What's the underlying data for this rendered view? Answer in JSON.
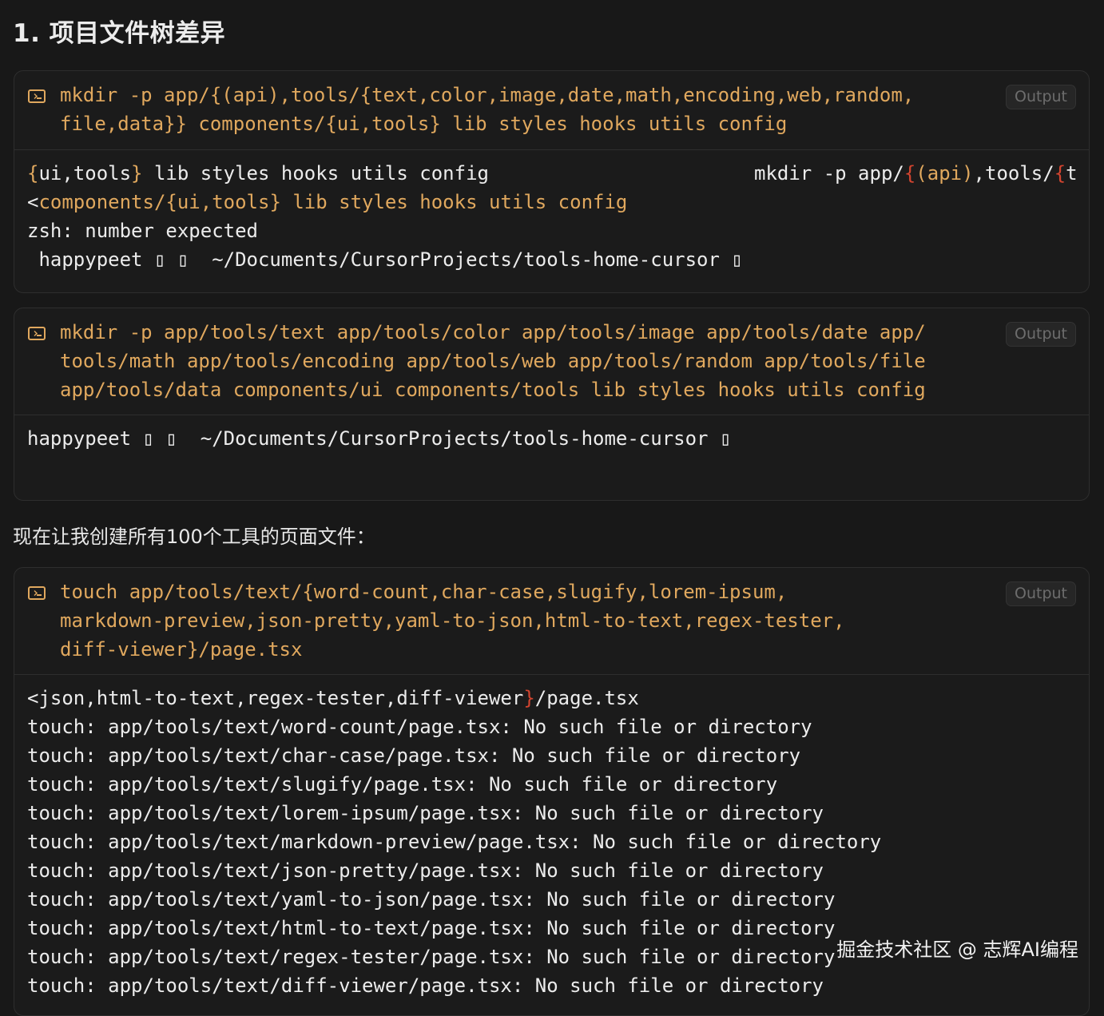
{
  "heading": "1. 项目文件树差异",
  "intro_text": "现在让我创建所有100个工具的页面文件：",
  "output_button_label": "Output",
  "block1": {
    "command": [
      "mkdir -p app/{(api),tools/{text,color,image,date,math,encoding,web,random,",
      "file,data}} components/{ui,tools} lib styles hooks utils config"
    ],
    "output": {
      "line1_left": {
        "a": "{",
        "b": "ui,tools",
        "c": "}",
        "d": " lib styles hooks utils config"
      },
      "line1_right": {
        "a": "mkdir -p app/",
        "b": "{",
        "c": "(api)",
        "d": ",tools/",
        "e": "{",
        "f": "t"
      },
      "line2": {
        "a": "<",
        "b": "components/{ui,tools} lib styles hooks utils config"
      },
      "line3": "zsh: number expected",
      "line4": " happypeet ▯ ▯  ~/Documents/CursorProjects/tools-home-cursor ▯"
    }
  },
  "block2": {
    "command": [
      "mkdir -p app/tools/text app/tools/color app/tools/image app/tools/date app/",
      "tools/math app/tools/encoding app/tools/web app/tools/random app/tools/file",
      "app/tools/data components/ui components/tools lib styles hooks utils config"
    ],
    "output": {
      "line1": "happypeet ▯ ▯  ~/Documents/CursorProjects/tools-home-cursor ▯"
    }
  },
  "block3": {
    "command": [
      "touch app/tools/text/{word-count,char-case,slugify,lorem-ipsum,",
      "markdown-preview,json-pretty,yaml-to-json,html-to-text,regex-tester,",
      "diff-viewer}/page.tsx"
    ],
    "output": {
      "line1": {
        "a": "<json,html-to-text,regex-tester,diff-viewer",
        "b": "}",
        "c": "/page.tsx"
      },
      "touch_lines": [
        "touch: app/tools/text/word-count/page.tsx: No such file or directory",
        "touch: app/tools/text/char-case/page.tsx: No such file or directory",
        "touch: app/tools/text/slugify/page.tsx: No such file or directory",
        "touch: app/tools/text/lorem-ipsum/page.tsx: No such file or directory",
        "touch: app/tools/text/markdown-preview/page.tsx: No such file or directory",
        "touch: app/tools/text/json-pretty/page.tsx: No such file or directory",
        "touch: app/tools/text/yaml-to-json/page.tsx: No such file or directory",
        "touch: app/tools/text/html-to-text/page.tsx: No such file or directory",
        "touch: app/tools/text/regex-tester/page.tsx: No such file or directory",
        "touch: app/tools/text/diff-viewer/page.tsx: No such file or directory"
      ]
    }
  },
  "watermark": "掘金技术社区 @ 志辉AI编程",
  "colors": {
    "background": "#181818",
    "command_text": "#e0a85e",
    "output_text": "#ececec",
    "brace_red": "#d2442f",
    "border": "#2e2e2e"
  }
}
